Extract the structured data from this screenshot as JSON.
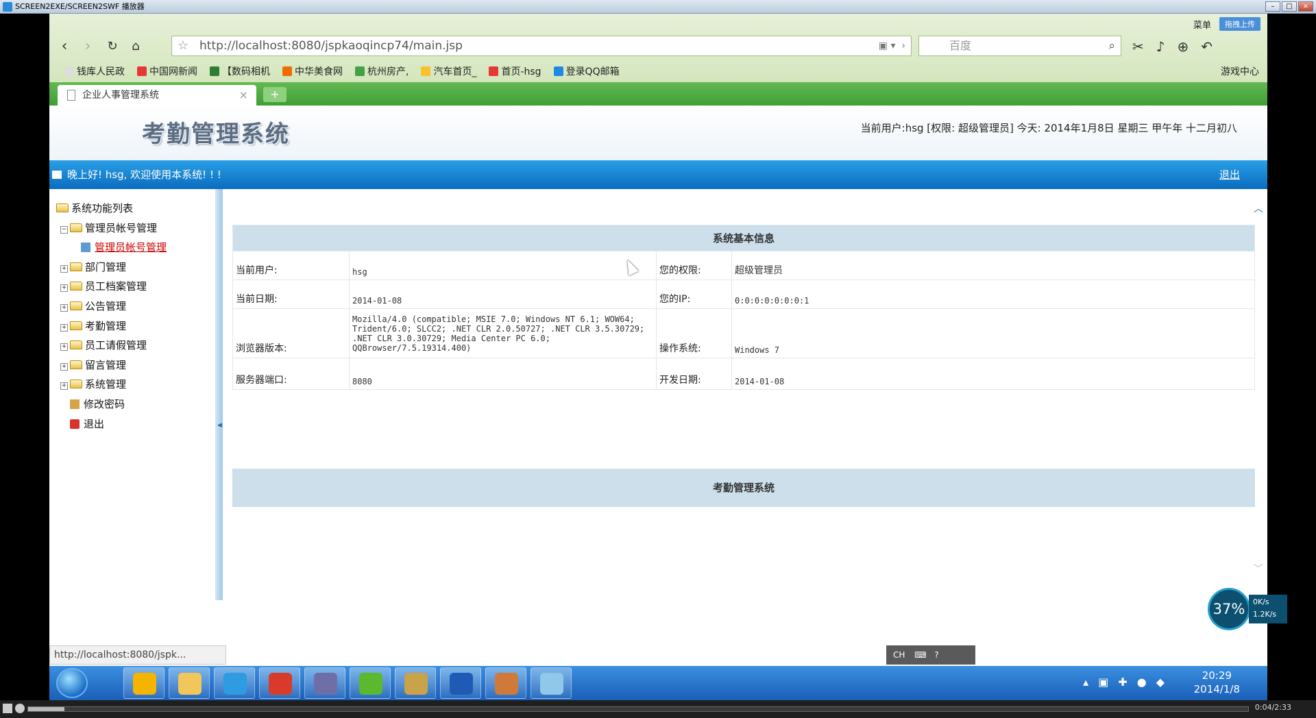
{
  "player": {
    "title": "SCREEN2EXE/SCREEN2SWF 播放器",
    "time": "0:04/2:33",
    "progress": 0.03
  },
  "browser": {
    "menu": "菜单",
    "upload": "拖拽上传",
    "url": "http://localhost:8080/jspkaoqincp74/main.jsp",
    "search_placeholder": "百度",
    "bookmarks": [
      {
        "label": "钱库人民政",
        "color": "#ddd"
      },
      {
        "label": "中国网新闻",
        "color": "#e53935"
      },
      {
        "label": "【数码相机",
        "color": "#2e7d32"
      },
      {
        "label": "中华美食网",
        "color": "#ef6c00"
      },
      {
        "label": "杭州房产,",
        "color": "#43a047"
      },
      {
        "label": "汽车首页_",
        "color": "#fbc02d"
      },
      {
        "label": "首页-hsg",
        "color": "#e53935"
      },
      {
        "label": "登录QQ邮箱",
        "color": "#1e88e5"
      }
    ],
    "game_center": "游戏中心",
    "tab_title": "企业人事管理系统",
    "status_url": "http://localhost:8080/jspk..."
  },
  "page": {
    "logo": "考勤管理系统",
    "user_info": "当前用户:hsg [权限: 超级管理员] 今天:  2014年1月8日 星期三 甲午年 十二月初八",
    "welcome": "晚上好! hsg, 欢迎使用本系统! ! !",
    "logout": "退出",
    "tree": {
      "root": "系统功能列表",
      "admin_group": "管理员帐号管理",
      "admin_link": "管理员帐号管理",
      "items": [
        "部门管理",
        "员工档案管理",
        "公告管理",
        "考勤管理",
        "员工请假管理",
        "留言管理",
        "系统管理"
      ],
      "change_password": "修改密码",
      "exit": "退出"
    },
    "info": {
      "heading": "系统基本信息",
      "rows": [
        {
          "l1": "当前用户:",
          "v1": "hsg",
          "l2": "您的权限:",
          "v2": "超级管理员"
        },
        {
          "l1": "当前日期:",
          "v1": "2014-01-08",
          "l2": "您的IP:",
          "v2": "0:0:0:0:0:0:0:1"
        },
        {
          "l1": "浏览器版本:",
          "v1": "Mozilla/4.0 (compatible; MSIE 7.0; Windows NT 6.1; WOW64; Trident/6.0; SLCC2; .NET CLR 2.0.50727; .NET CLR 3.5.30729; .NET CLR 3.0.30729; Media Center PC 6.0; QQBrowser/7.5.19314.400)",
          "l2": "操作系统:",
          "v2": "Windows 7"
        },
        {
          "l1": "服务器端口:",
          "v1": "8080",
          "l2": "开发日期:",
          "v2": "2014-01-08"
        }
      ],
      "band": "考勤管理系统"
    }
  },
  "overlay": {
    "ime": "CH",
    "speed_percent": "37%",
    "up_rate": "0K/s",
    "down_rate": "1.2K/s"
  },
  "taskbar": {
    "time": "20:29",
    "date": "2014/1/8",
    "apps": [
      {
        "name": "color-app",
        "color": "#f4b400"
      },
      {
        "name": "folder",
        "color": "#f1c75b"
      },
      {
        "name": "qq-browser",
        "color": "#2f9be0"
      },
      {
        "name": "game",
        "color": "#d93b2b"
      },
      {
        "name": "eclipse",
        "color": "#6f6fa8"
      },
      {
        "name": "media",
        "color": "#5cb82e"
      },
      {
        "name": "tools",
        "color": "#c9a24a"
      },
      {
        "name": "word",
        "color": "#1f5bb5"
      },
      {
        "name": "users",
        "color": "#d07a3a"
      },
      {
        "name": "notes",
        "color": "#8fc8e8"
      }
    ]
  }
}
